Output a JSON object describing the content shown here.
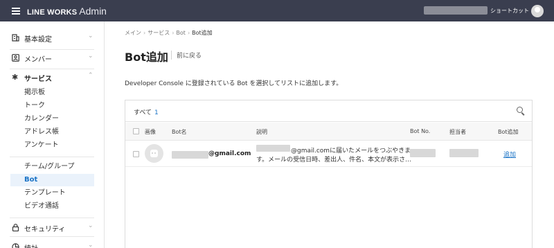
{
  "topbar": {
    "brand": "LINE WORKS",
    "admin": "Admin",
    "shortcut": "ショートカット"
  },
  "sidebar": {
    "groups": [
      {
        "label": "基本設定",
        "icon": "building-icon"
      },
      {
        "label": "メンバー",
        "icon": "person-icon"
      },
      {
        "label": "サービス",
        "icon": "gear-icon"
      },
      {
        "label": "セキュリティ",
        "icon": "lock-icon"
      },
      {
        "label": "統計",
        "icon": "chart-icon"
      }
    ],
    "service_items": [
      "掲示板",
      "トーク",
      "カレンダー",
      "アドレス帳",
      "アンケート",
      "チーム/グループ",
      "Bot",
      "テンプレート",
      "ビデオ通話"
    ],
    "active_item": "Bot"
  },
  "breadcrumb": [
    "メイン",
    "サービス",
    "Bot",
    "Bot追加"
  ],
  "page": {
    "title": "Bot追加",
    "back": "前に戻る",
    "description": "Developer Console に登録されている Bot を選択してリストに追加します。"
  },
  "panel": {
    "tab_label": "すべて",
    "tab_count": "1",
    "columns": [
      "画像",
      "Bot名",
      "説明",
      "Bot No.",
      "担当者",
      "Bot追加"
    ]
  },
  "rows": [
    {
      "name_suffix": "@gmail.com",
      "desc_line1": "@gmail.comに届いたメールをつぶやきま",
      "desc_line2": "す。メールの受信日時、差出人、件名、本文が表示され…",
      "action": "追加"
    }
  ]
}
